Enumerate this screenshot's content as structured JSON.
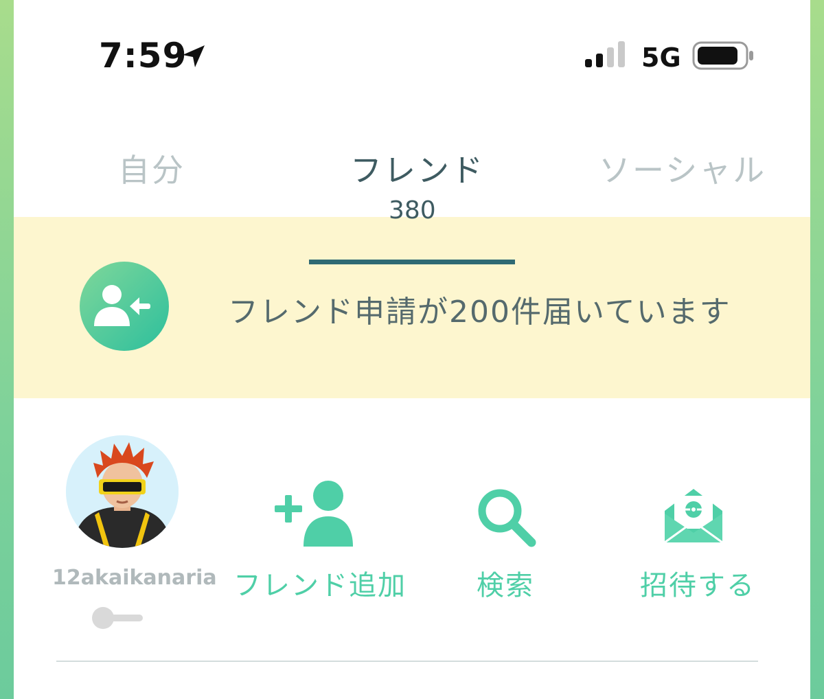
{
  "status_bar": {
    "time": "7:59",
    "network": "5G",
    "icons": [
      "location-arrow-icon",
      "signal-icon",
      "battery-icon"
    ]
  },
  "tabs": [
    {
      "label": "自分",
      "active": false
    },
    {
      "label": "フレンド",
      "active": true,
      "count": "380"
    },
    {
      "label": "ソーシャル",
      "active": false
    }
  ],
  "banner": {
    "text": "フレンド申請が200件届いています",
    "icon": "friend-request-icon"
  },
  "profile": {
    "username": "12akaikanaria",
    "toggle_on": false
  },
  "actions": [
    {
      "label": "フレンド追加",
      "icon": "add-friend-icon"
    },
    {
      "label": "検索",
      "icon": "search-icon"
    },
    {
      "label": "招待する",
      "icon": "invite-envelope-icon"
    }
  ],
  "colors": {
    "accent": "#4fcfa7",
    "tab_active": "#3e5b61",
    "tab_inactive": "#b9c4c6",
    "banner_bg": "#fdf6cf",
    "underline": "#2f6a74"
  }
}
